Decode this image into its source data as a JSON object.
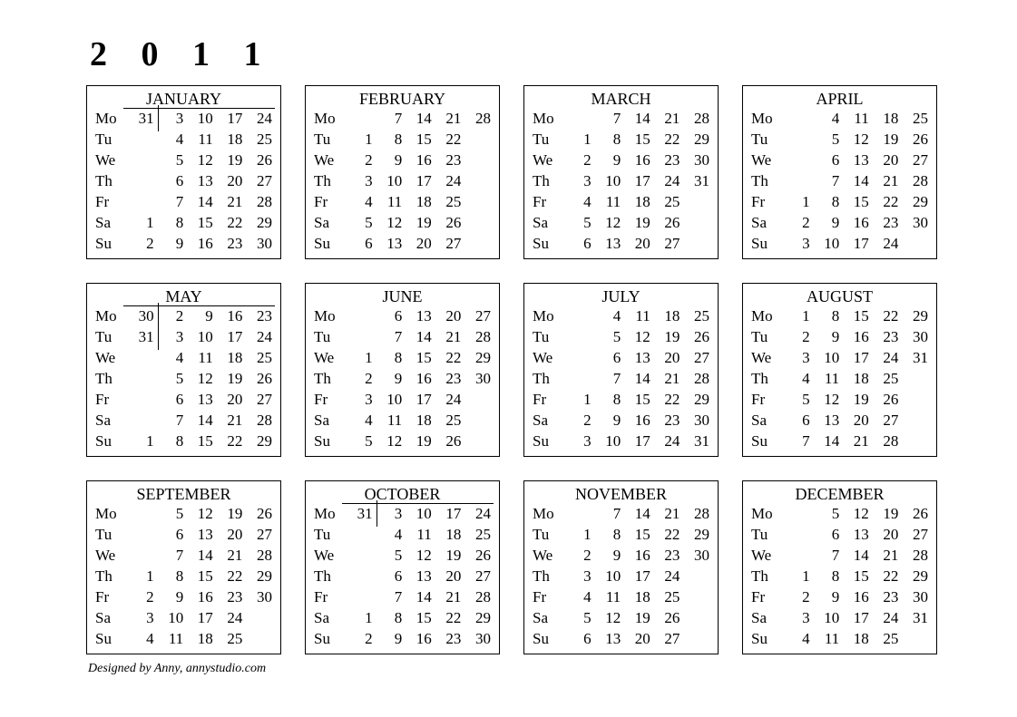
{
  "year": "2 0 1 1",
  "day_headers": [
    "Mo",
    "Tu",
    "We",
    "Th",
    "Fr",
    "Sa",
    "Su"
  ],
  "months": [
    {
      "name": "JANUARY",
      "overflow_rows": 1,
      "rows": [
        [
          "31",
          "3",
          "10",
          "17",
          "24"
        ],
        [
          "",
          "4",
          "11",
          "18",
          "25"
        ],
        [
          "",
          "5",
          "12",
          "19",
          "26"
        ],
        [
          "",
          "6",
          "13",
          "20",
          "27"
        ],
        [
          "",
          "7",
          "14",
          "21",
          "28"
        ],
        [
          "1",
          "8",
          "15",
          "22",
          "29"
        ],
        [
          "2",
          "9",
          "16",
          "23",
          "30"
        ]
      ]
    },
    {
      "name": "FEBRUARY",
      "overflow_rows": 0,
      "rows": [
        [
          "",
          "7",
          "14",
          "21",
          "28"
        ],
        [
          "1",
          "8",
          "15",
          "22",
          ""
        ],
        [
          "2",
          "9",
          "16",
          "23",
          ""
        ],
        [
          "3",
          "10",
          "17",
          "24",
          ""
        ],
        [
          "4",
          "11",
          "18",
          "25",
          ""
        ],
        [
          "5",
          "12",
          "19",
          "26",
          ""
        ],
        [
          "6",
          "13",
          "20",
          "27",
          ""
        ]
      ]
    },
    {
      "name": "MARCH",
      "overflow_rows": 0,
      "rows": [
        [
          "",
          "7",
          "14",
          "21",
          "28"
        ],
        [
          "1",
          "8",
          "15",
          "22",
          "29"
        ],
        [
          "2",
          "9",
          "16",
          "23",
          "30"
        ],
        [
          "3",
          "10",
          "17",
          "24",
          "31"
        ],
        [
          "4",
          "11",
          "18",
          "25",
          ""
        ],
        [
          "5",
          "12",
          "19",
          "26",
          ""
        ],
        [
          "6",
          "13",
          "20",
          "27",
          ""
        ]
      ]
    },
    {
      "name": "APRIL",
      "overflow_rows": 0,
      "rows": [
        [
          "",
          "4",
          "11",
          "18",
          "25"
        ],
        [
          "",
          "5",
          "12",
          "19",
          "26"
        ],
        [
          "",
          "6",
          "13",
          "20",
          "27"
        ],
        [
          "",
          "7",
          "14",
          "21",
          "28"
        ],
        [
          "1",
          "8",
          "15",
          "22",
          "29"
        ],
        [
          "2",
          "9",
          "16",
          "23",
          "30"
        ],
        [
          "3",
          "10",
          "17",
          "24",
          ""
        ]
      ]
    },
    {
      "name": "MAY",
      "overflow_rows": 2,
      "rows": [
        [
          "30",
          "2",
          "9",
          "16",
          "23"
        ],
        [
          "31",
          "3",
          "10",
          "17",
          "24"
        ],
        [
          "",
          "4",
          "11",
          "18",
          "25"
        ],
        [
          "",
          "5",
          "12",
          "19",
          "26"
        ],
        [
          "",
          "6",
          "13",
          "20",
          "27"
        ],
        [
          "",
          "7",
          "14",
          "21",
          "28"
        ],
        [
          "1",
          "8",
          "15",
          "22",
          "29"
        ]
      ]
    },
    {
      "name": "JUNE",
      "overflow_rows": 0,
      "rows": [
        [
          "",
          "6",
          "13",
          "20",
          "27"
        ],
        [
          "",
          "7",
          "14",
          "21",
          "28"
        ],
        [
          "1",
          "8",
          "15",
          "22",
          "29"
        ],
        [
          "2",
          "9",
          "16",
          "23",
          "30"
        ],
        [
          "3",
          "10",
          "17",
          "24",
          ""
        ],
        [
          "4",
          "11",
          "18",
          "25",
          ""
        ],
        [
          "5",
          "12",
          "19",
          "26",
          ""
        ]
      ]
    },
    {
      "name": "JULY",
      "overflow_rows": 0,
      "rows": [
        [
          "",
          "4",
          "11",
          "18",
          "25"
        ],
        [
          "",
          "5",
          "12",
          "19",
          "26"
        ],
        [
          "",
          "6",
          "13",
          "20",
          "27"
        ],
        [
          "",
          "7",
          "14",
          "21",
          "28"
        ],
        [
          "1",
          "8",
          "15",
          "22",
          "29"
        ],
        [
          "2",
          "9",
          "16",
          "23",
          "30"
        ],
        [
          "3",
          "10",
          "17",
          "24",
          "31"
        ]
      ]
    },
    {
      "name": "AUGUST",
      "overflow_rows": 0,
      "rows": [
        [
          "1",
          "8",
          "15",
          "22",
          "29"
        ],
        [
          "2",
          "9",
          "16",
          "23",
          "30"
        ],
        [
          "3",
          "10",
          "17",
          "24",
          "31"
        ],
        [
          "4",
          "11",
          "18",
          "25",
          ""
        ],
        [
          "5",
          "12",
          "19",
          "26",
          ""
        ],
        [
          "6",
          "13",
          "20",
          "27",
          ""
        ],
        [
          "7",
          "14",
          "21",
          "28",
          ""
        ]
      ]
    },
    {
      "name": "SEPTEMBER",
      "overflow_rows": 0,
      "rows": [
        [
          "",
          "5",
          "12",
          "19",
          "26"
        ],
        [
          "",
          "6",
          "13",
          "20",
          "27"
        ],
        [
          "",
          "7",
          "14",
          "21",
          "28"
        ],
        [
          "1",
          "8",
          "15",
          "22",
          "29"
        ],
        [
          "2",
          "9",
          "16",
          "23",
          "30"
        ],
        [
          "3",
          "10",
          "17",
          "24",
          ""
        ],
        [
          "4",
          "11",
          "18",
          "25",
          ""
        ]
      ]
    },
    {
      "name": "OCTOBER",
      "overflow_rows": 1,
      "rows": [
        [
          "31",
          "3",
          "10",
          "17",
          "24"
        ],
        [
          "",
          "4",
          "11",
          "18",
          "25"
        ],
        [
          "",
          "5",
          "12",
          "19",
          "26"
        ],
        [
          "",
          "6",
          "13",
          "20",
          "27"
        ],
        [
          "",
          "7",
          "14",
          "21",
          "28"
        ],
        [
          "1",
          "8",
          "15",
          "22",
          "29"
        ],
        [
          "2",
          "9",
          "16",
          "23",
          "30"
        ]
      ]
    },
    {
      "name": "NOVEMBER",
      "overflow_rows": 0,
      "rows": [
        [
          "",
          "7",
          "14",
          "21",
          "28"
        ],
        [
          "1",
          "8",
          "15",
          "22",
          "29"
        ],
        [
          "2",
          "9",
          "16",
          "23",
          "30"
        ],
        [
          "3",
          "10",
          "17",
          "24",
          ""
        ],
        [
          "4",
          "11",
          "18",
          "25",
          ""
        ],
        [
          "5",
          "12",
          "19",
          "26",
          ""
        ],
        [
          "6",
          "13",
          "20",
          "27",
          ""
        ]
      ]
    },
    {
      "name": "DECEMBER",
      "overflow_rows": 0,
      "rows": [
        [
          "",
          "5",
          "12",
          "19",
          "26"
        ],
        [
          "",
          "6",
          "13",
          "20",
          "27"
        ],
        [
          "",
          "7",
          "14",
          "21",
          "28"
        ],
        [
          "1",
          "8",
          "15",
          "22",
          "29"
        ],
        [
          "2",
          "9",
          "16",
          "23",
          "30"
        ],
        [
          "3",
          "10",
          "17",
          "24",
          "31"
        ],
        [
          "4",
          "11",
          "18",
          "25",
          ""
        ]
      ]
    }
  ],
  "credit": "Designed by Anny,  annystudio.com"
}
